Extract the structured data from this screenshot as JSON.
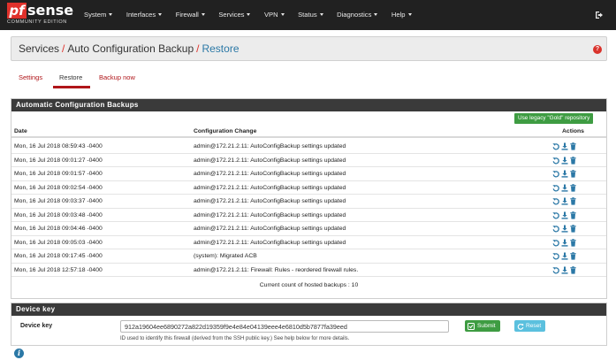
{
  "brand": {
    "logo_pf": "pf",
    "logo_sense": "sense",
    "edition": "COMMUNITY EDITION"
  },
  "nav": {
    "items": [
      {
        "label": "System"
      },
      {
        "label": "Interfaces"
      },
      {
        "label": "Firewall"
      },
      {
        "label": "Services"
      },
      {
        "label": "VPN"
      },
      {
        "label": "Status"
      },
      {
        "label": "Diagnostics"
      },
      {
        "label": "Help"
      }
    ]
  },
  "breadcrumb": {
    "part1": "Services",
    "part2": "Auto Configuration Backup",
    "part3": "Restore",
    "separator": "/"
  },
  "tabs": [
    {
      "label": "Settings"
    },
    {
      "label": "Restore",
      "active": true
    },
    {
      "label": "Backup now"
    }
  ],
  "backups_panel": {
    "title": "Automatic Configuration Backups",
    "legacy_button": "Use legacy \"Gold\" repository",
    "columns": {
      "date": "Date",
      "change": "Configuration Change",
      "actions": "Actions"
    },
    "rows": [
      {
        "date": "Mon, 16 Jul 2018 08:59:43 -0400",
        "change": "admin@172.21.2.11: AutoConfigBackup settings updated"
      },
      {
        "date": "Mon, 16 Jul 2018 09:01:27 -0400",
        "change": "admin@172.21.2.11: AutoConfigBackup settings updated"
      },
      {
        "date": "Mon, 16 Jul 2018 09:01:57 -0400",
        "change": "admin@172.21.2.11: AutoConfigBackup settings updated"
      },
      {
        "date": "Mon, 16 Jul 2018 09:02:54 -0400",
        "change": "admin@172.21.2.11: AutoConfigBackup settings updated"
      },
      {
        "date": "Mon, 16 Jul 2018 09:03:37 -0400",
        "change": "admin@172.21.2.11: AutoConfigBackup settings updated"
      },
      {
        "date": "Mon, 16 Jul 2018 09:03:48 -0400",
        "change": "admin@172.21.2.11: AutoConfigBackup settings updated"
      },
      {
        "date": "Mon, 16 Jul 2018 09:04:46 -0400",
        "change": "admin@172.21.2.11: AutoConfigBackup settings updated"
      },
      {
        "date": "Mon, 16 Jul 2018 09:05:03 -0400",
        "change": "admin@172.21.2.11: AutoConfigBackup settings updated"
      },
      {
        "date": "Mon, 16 Jul 2018 09:17:45 -0400",
        "change": "(system): Migrated ACB"
      },
      {
        "date": "Mon, 16 Jul 2018 12:57:18 -0400",
        "change": "admin@172.21.2.11: Firewall: Rules - reordered firewall rules."
      }
    ],
    "count_text": "Current count of hosted backups : 10"
  },
  "device_key_panel": {
    "title": "Device key",
    "label": "Device key",
    "value": "912a19604ee6890272a822d19359f9e4e84e04139eee4e6810d5b7877fa39eed",
    "help": "ID used to identify this firewall (derived from the SSH public key.) See help below for more details.",
    "submit_label": "Submit",
    "reset_label": "Reset"
  },
  "colors": {
    "navbar": "#212121",
    "brand_red": "#e0312b",
    "tab_red": "#b0161a",
    "link_blue": "#2b78a6",
    "success_green": "#3e9c42",
    "info_blue": "#5bc0de",
    "panel_heading": "#3a3a3a"
  },
  "icons": {
    "restore": "undo-icon",
    "download": "download-icon",
    "delete": "trash-icon",
    "help": "question-circle-icon",
    "info": "info-circle-icon",
    "logout": "sign-out-icon"
  }
}
